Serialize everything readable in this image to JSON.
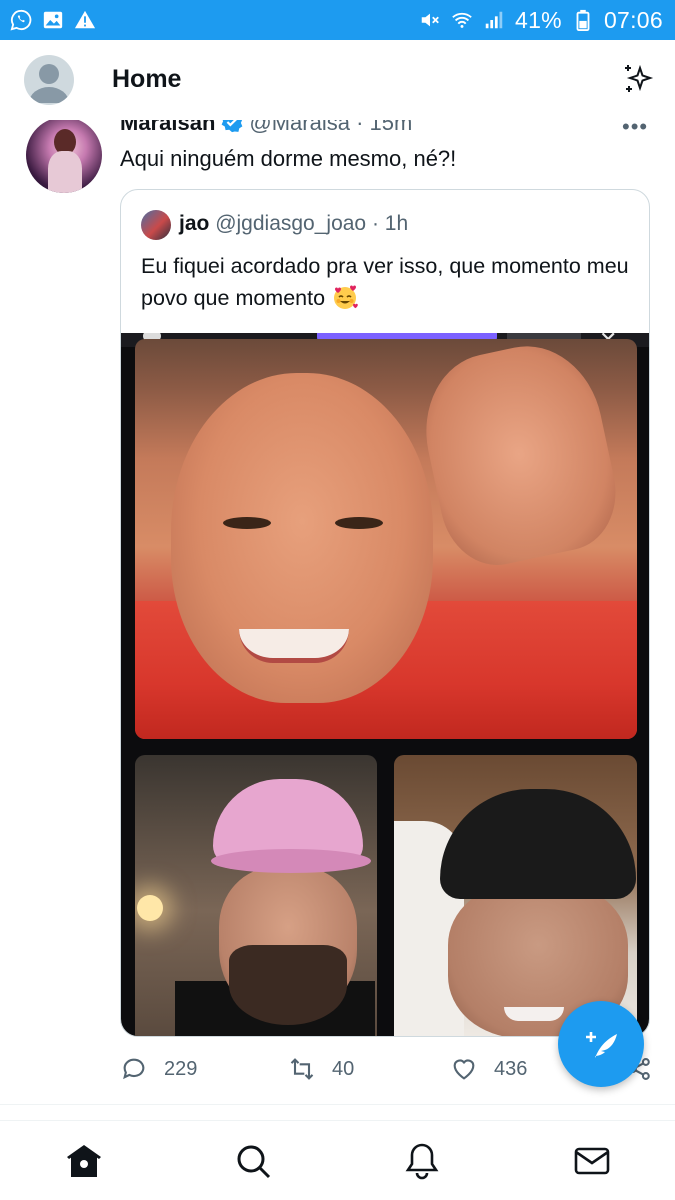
{
  "status_bar": {
    "battery": "41%",
    "time": "07:06",
    "left_icons": [
      "whatsapp-icon",
      "image-icon",
      "warning-icon"
    ],
    "right_icons": [
      "mute-icon",
      "wifi-icon",
      "signal-icon",
      "battery-icon"
    ]
  },
  "header": {
    "title": "Home"
  },
  "tweet": {
    "author_name": "Maraisah",
    "author_handle": "@Maraisa",
    "time": "· 15m",
    "more": "•••",
    "text": "Aqui ninguém dorme mesmo, né?!",
    "quote": {
      "author_name": "jao",
      "author_handle": "@jgdiasgo_joao",
      "time": "· 1h",
      "text": "Eu fiquei acordado pra ver isso, que momento meu povo que momento"
    },
    "actions": {
      "replies": "229",
      "retweets": "40",
      "likes": "436"
    }
  },
  "bottom_nav": {
    "items": [
      "home-icon",
      "search-icon",
      "notifications-icon",
      "messages-icon"
    ]
  },
  "colors": {
    "brand": "#1d9bf0",
    "text_primary": "#0f1419",
    "text_secondary": "#536471"
  }
}
